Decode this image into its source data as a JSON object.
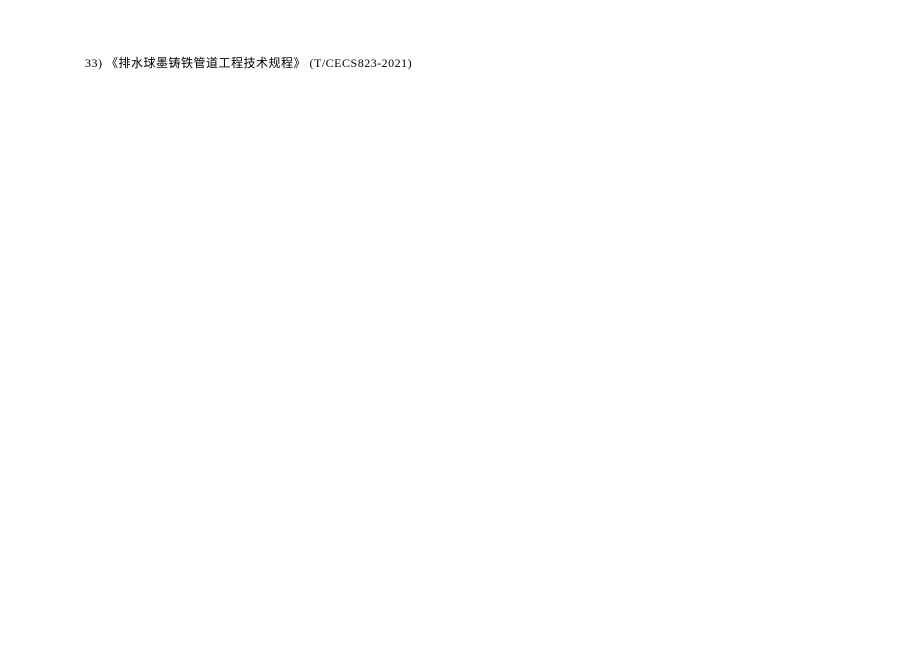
{
  "document": {
    "lines": [
      {
        "number": "33)",
        "title": "《排水球墨铸铁管道工程技术规程》",
        "code": "(T/CECS823-2021)"
      }
    ]
  }
}
